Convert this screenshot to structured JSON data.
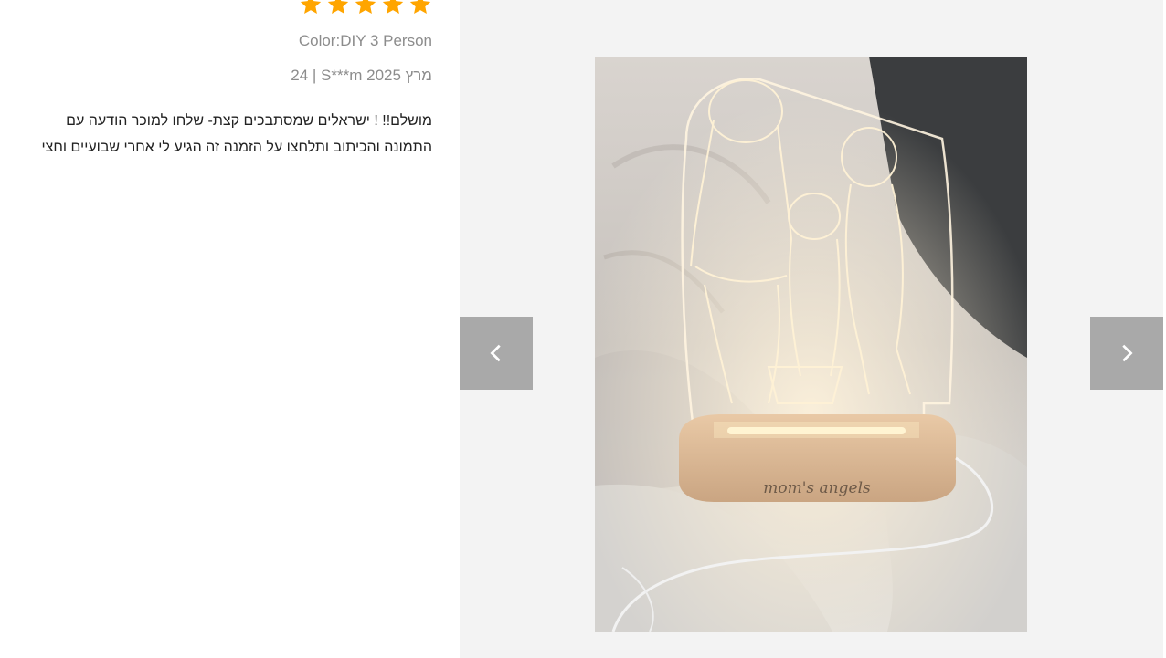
{
  "review": {
    "rating": 5,
    "rating_max": 5,
    "star_color": "#FFA500",
    "color_label": "Color:DIY 3 Person",
    "meta": "24 | S***m מרץ 2025",
    "text": "מושלם!! ! ישראלים שמסתבכים קצת- שלחו למוכר הודעה עם התמונה והכיתוב ותלחצו על הזמנה זה הגיע לי אחרי שבועיים וחצי"
  },
  "gallery": {
    "engraving_text": "mom's angels",
    "prev_icon": "chevron-left-icon",
    "next_icon": "chevron-right-icon"
  }
}
